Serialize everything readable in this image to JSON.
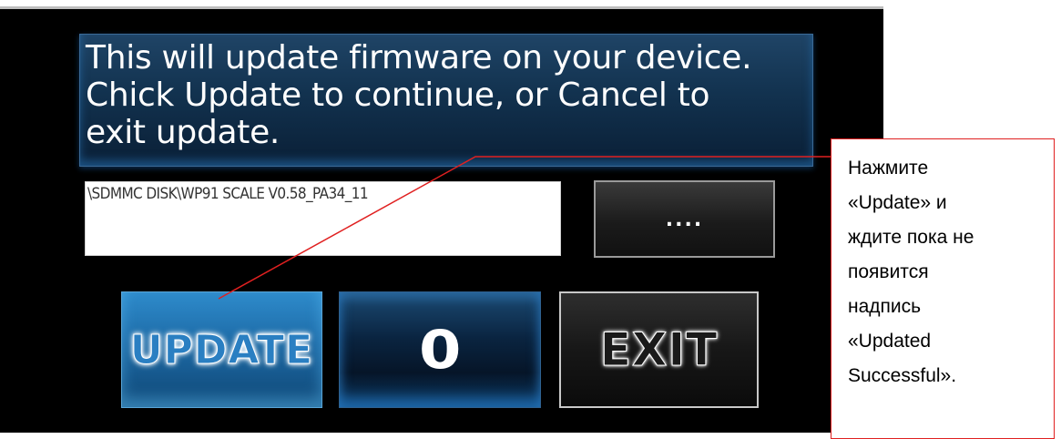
{
  "dialog": {
    "message_lines": [
      "This will update firmware on your device.",
      "Chick Update to continue, or Cancel to",
      "exit update."
    ],
    "file_path": "\\SDMMC DISK\\WP91 SCALE V0.58_PA34_11",
    "browse_label": "....",
    "update_label": "UPDATE",
    "counter_value": "0",
    "exit_label": "EXIT"
  },
  "callout": {
    "lines": [
      "Нажмите",
      "«Update» и",
      "ждите пока не",
      "появится",
      "надпись",
      "«Updated",
      "Successful»."
    ]
  },
  "colors": {
    "accent_blue": "#1d6aa6",
    "callout_border": "#e02020",
    "leader_line": "#e02020"
  }
}
